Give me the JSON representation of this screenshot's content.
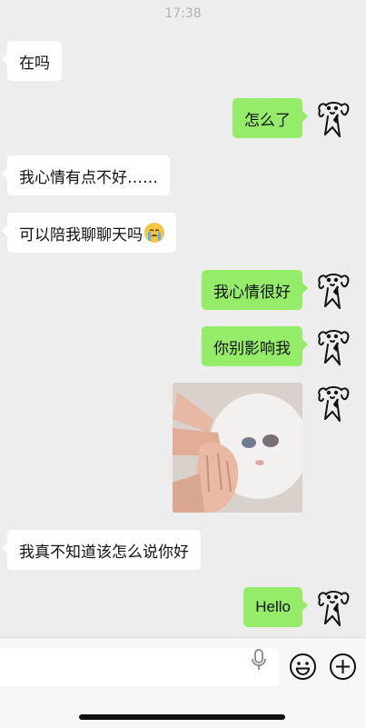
{
  "status": {
    "time": "17:38"
  },
  "messages": {
    "m1": "在吗",
    "m2": "怎么了",
    "m3": "我心情有点不好……",
    "m4": "可以陪我聊聊天吗",
    "m4_emoji": "loudly-crying-emoji",
    "m5": "我心情很好",
    "m6": "你别影响我",
    "m7_sticker": "cat-hands-sticker",
    "m8": "我真不知道该怎么说你好",
    "m9": "Hello"
  },
  "input": {
    "value": "",
    "placeholder": ""
  },
  "icons": {
    "avatar": "dog-doodle-avatar",
    "mic": "microphone-icon",
    "emoji": "smiley-icon",
    "plus": "plus-icon"
  },
  "colors": {
    "background": "#ededed",
    "outgoing_bubble": "#95ec69",
    "incoming_bubble": "#ffffff"
  }
}
